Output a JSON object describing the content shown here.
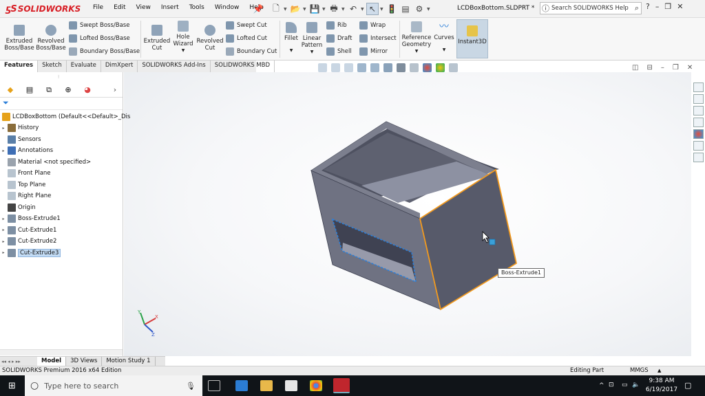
{
  "app": {
    "logo_text": "SOLIDWORKS",
    "menus": [
      "File",
      "Edit",
      "View",
      "Insert",
      "Tools",
      "Window",
      "Help"
    ],
    "doc_title": "LCDBoxBottom.SLDPRT *",
    "help_placeholder": "Search SOLIDWORKS Help"
  },
  "commands": {
    "extruded_boss": "Extruded Boss/Base",
    "revolved_boss": "Revolved Boss/Base",
    "swept_boss": "Swept Boss/Base",
    "lofted_boss": "Lofted Boss/Base",
    "boundary_boss": "Boundary Boss/Base",
    "extruded_cut": "Extruded Cut",
    "hole_wizard": "Hole Wizard",
    "revolved_cut": "Revolved Cut",
    "swept_cut": "Swept Cut",
    "lofted_cut": "Lofted Cut",
    "boundary_cut": "Boundary Cut",
    "fillet": "Fillet",
    "linear_pattern": "Linear Pattern",
    "rib": "Rib",
    "draft": "Draft",
    "shell": "Shell",
    "wrap": "Wrap",
    "intersect": "Intersect",
    "mirror": "Mirror",
    "reference_geometry": "Reference Geometry",
    "curves": "Curves",
    "instant3d": "Instant3D"
  },
  "tabs": [
    "Features",
    "Sketch",
    "Evaluate",
    "DimXpert",
    "SOLIDWORKS Add-Ins",
    "SOLIDWORKS MBD"
  ],
  "tree": {
    "root": "LCDBoxBottom  (Default<<Default>_Dis",
    "items": [
      {
        "label": "History",
        "icon": "history-icon",
        "color": "#8a6d3b",
        "expandable": true
      },
      {
        "label": "Sensors",
        "icon": "sensor-icon",
        "color": "#5a7fa8",
        "expandable": false
      },
      {
        "label": "Annotations",
        "icon": "annotation-icon",
        "color": "#3f6fb5",
        "expandable": true
      },
      {
        "label": "Material <not specified>",
        "icon": "material-icon",
        "color": "#9aa3ad",
        "expandable": false
      },
      {
        "label": "Front Plane",
        "icon": "plane-icon",
        "color": "#b8c4cf",
        "expandable": false
      },
      {
        "label": "Top Plane",
        "icon": "plane-icon",
        "color": "#b8c4cf",
        "expandable": false
      },
      {
        "label": "Right Plane",
        "icon": "plane-icon",
        "color": "#b8c4cf",
        "expandable": false
      },
      {
        "label": "Origin",
        "icon": "origin-icon",
        "color": "#444444",
        "expandable": false
      },
      {
        "label": "Boss-Extrude1",
        "icon": "extrude-icon",
        "color": "#7d8fa3",
        "expandable": true
      },
      {
        "label": "Cut-Extrude1",
        "icon": "cut-extrude-icon",
        "color": "#7d8fa3",
        "expandable": true
      },
      {
        "label": "Cut-Extrude2",
        "icon": "cut-extrude-icon",
        "color": "#7d8fa3",
        "expandable": true
      },
      {
        "label": "Cut-Extrude3",
        "icon": "cut-extrude-icon",
        "color": "#7d8fa3",
        "expandable": true,
        "selected": true
      }
    ]
  },
  "viewport": {
    "tooltip": "Boss-Extrude1",
    "triad_labels": [
      "Y",
      "X",
      "Z"
    ]
  },
  "bottom_tabs": [
    "Model",
    "3D Views",
    "Motion Study 1"
  ],
  "status": {
    "product": "SOLIDWORKS Premium 2016 x64 Edition",
    "mode": "Editing Part",
    "units": "MMGS"
  },
  "taskbar": {
    "search_placeholder": "Type here to search",
    "time": "9:38 AM",
    "date": "6/19/2017"
  },
  "colors": {
    "accent_red": "#d81f26",
    "model_face": "#5b5e6c",
    "highlight_orange": "#f39a1e",
    "selection_blue": "#2c7fd8"
  }
}
